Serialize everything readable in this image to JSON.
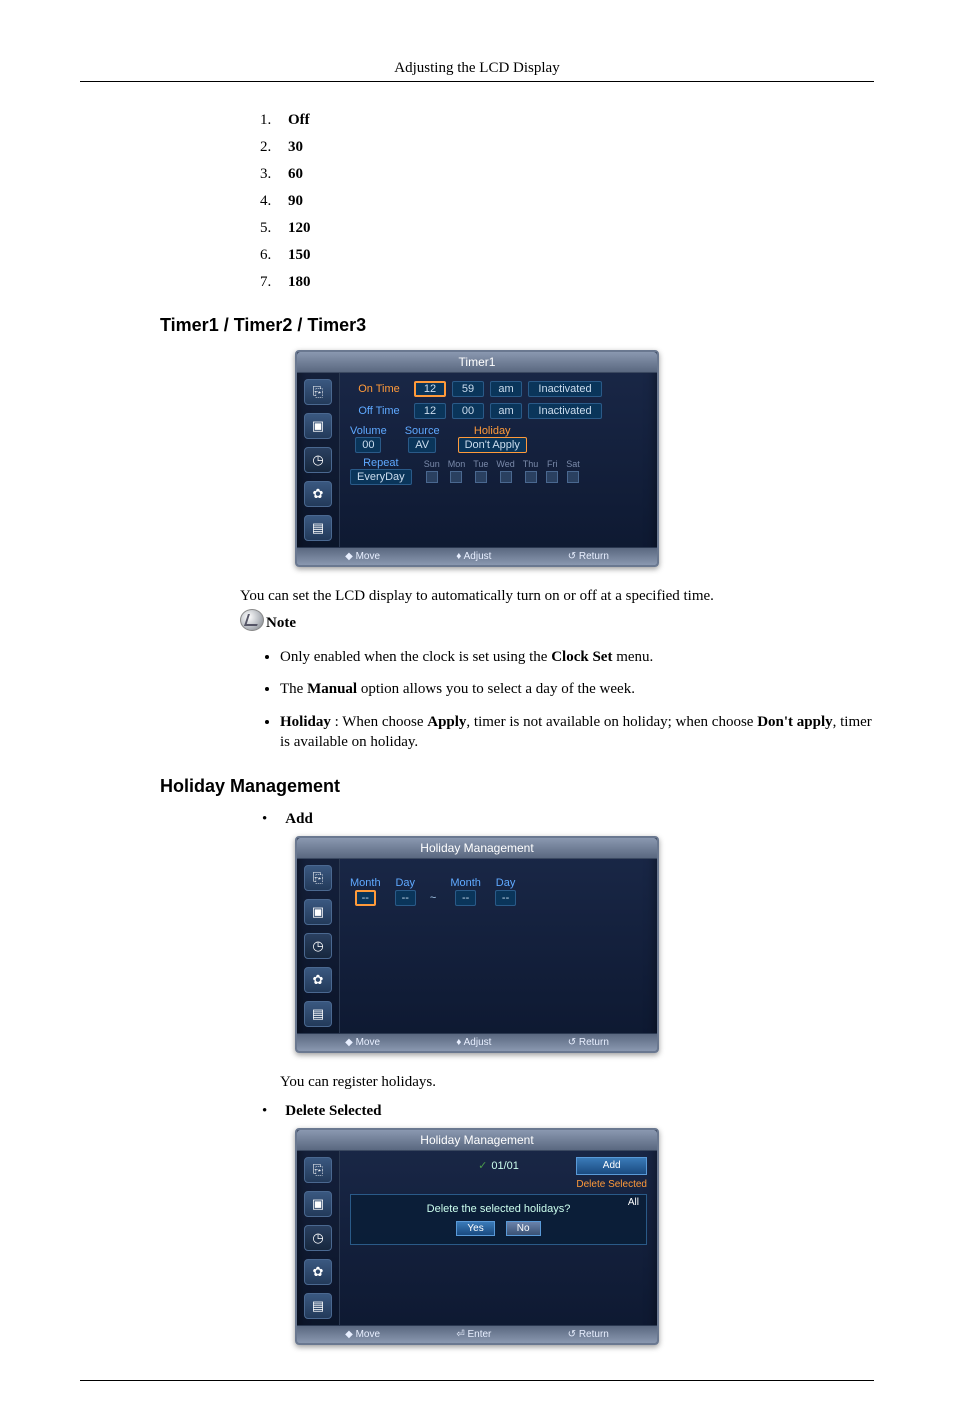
{
  "header": "Adjusting the LCD Display",
  "numbered_list": [
    {
      "num": "1.",
      "label": "Off"
    },
    {
      "num": "2.",
      "label": "30"
    },
    {
      "num": "3.",
      "label": "60"
    },
    {
      "num": "4.",
      "label": "90"
    },
    {
      "num": "5.",
      "label": "120"
    },
    {
      "num": "6.",
      "label": "150"
    },
    {
      "num": "7.",
      "label": "180"
    }
  ],
  "section1_title": "Timer1 / Timer2 / Timer3",
  "osd1": {
    "title": "Timer1",
    "ontime_label": "On Time",
    "ontime_h": "12",
    "ontime_m": "59",
    "ontime_ampm": "am",
    "ontime_state": "Inactivated",
    "offtime_label": "Off Time",
    "offtime_h": "12",
    "offtime_m": "00",
    "offtime_ampm": "am",
    "offtime_state": "Inactivated",
    "volume_label": "Volume",
    "volume_val": "00",
    "source_label": "Source",
    "source_val": "AV",
    "holiday_label": "Holiday",
    "holiday_val": "Don't Apply",
    "repeat_label": "Repeat",
    "repeat_val": "EveryDay",
    "days": [
      "Sun",
      "Mon",
      "Tue",
      "Wed",
      "Thu",
      "Fri",
      "Sat"
    ],
    "foot_move": "Move",
    "foot_adjust": "Adjust",
    "foot_return": "Return"
  },
  "desc1": "You can set the LCD display to automatically turn on or off at a specified time.",
  "note_label": "Note",
  "notes": [
    {
      "pre": "Only enabled when the clock is set using the ",
      "b1": "Clock Set",
      "post": " menu."
    },
    {
      "pre": "The ",
      "b1": "Manual",
      "post": " option allows you to select a day of the week."
    }
  ],
  "note3": {
    "b1": "Holiday",
    "mid": " : When choose ",
    "b2": "Apply",
    "mid2": ", timer is not available on holiday; when choose ",
    "b3": "Don't apply",
    "post": ", timer is available on holiday."
  },
  "section2_title": "Holiday Management",
  "add_label": "Add",
  "osd2": {
    "title": "Holiday Management",
    "month": "Month",
    "day": "Day",
    "v1": "--",
    "v2": "--",
    "v3": "--",
    "v4": "--",
    "foot_move": "Move",
    "foot_adjust": "Adjust",
    "foot_return": "Return"
  },
  "desc2": "You can register holidays.",
  "del_label": "Delete Selected",
  "osd3": {
    "title": "Holiday Management",
    "date": "01/01",
    "right_add": "Add",
    "right_del": "Delete Selected",
    "right_all": "All",
    "modal_q": "Delete the selected holidays?",
    "yes": "Yes",
    "no": "No",
    "foot_move": "Move",
    "foot_enter": "Enter",
    "foot_return": "Return"
  }
}
